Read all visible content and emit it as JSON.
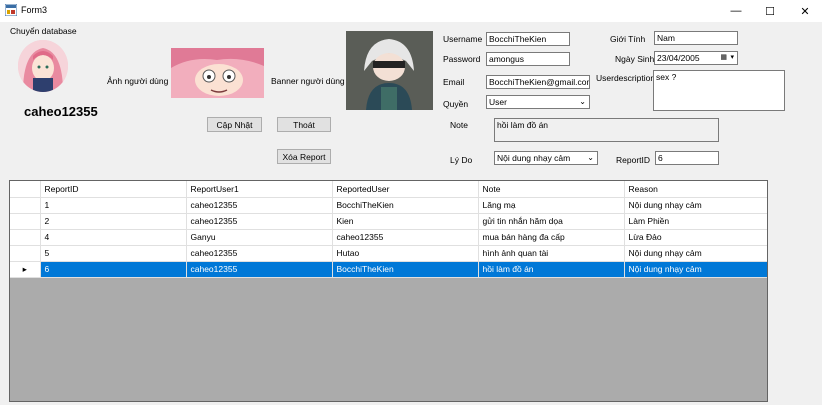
{
  "window": {
    "title": "Form3",
    "minimize": "—",
    "maximize": "☐",
    "close": "✕"
  },
  "menu": {
    "database": "Chuyển database"
  },
  "profile": {
    "username_display": "caheo12355",
    "avatar_label": "Ảnh người dùng",
    "banner_label": "Banner người dùng"
  },
  "buttons": {
    "update": "Cập Nhật",
    "exit": "Thoát",
    "delete_report": "Xóa Report"
  },
  "form": {
    "username_label": "Username",
    "username_value": "BocchiTheKien",
    "password_label": "Password",
    "password_value": "amongus",
    "email_label": "Email",
    "email_value": "BocchiTheKien@gmail.com",
    "role_label": "Quyền",
    "role_value": "User",
    "gender_label": "Giới Tính",
    "gender_value": "Nam",
    "birthday_label": "Ngày Sinh",
    "birthday_value": "23/04/2005",
    "description_label": "Userdescription",
    "description_value": "sex ?",
    "note_label": "Note",
    "note_value": "hồi làm đồ án",
    "reason_label": "Lý Do",
    "reason_value": "Nội dung nhạy cảm",
    "reportid_label": "ReportID",
    "reportid_value": "6"
  },
  "table": {
    "columns": [
      "ReportID",
      "ReportUser1",
      "ReportedUser",
      "Note",
      "Reason"
    ],
    "rows": [
      [
        "1",
        "caheo12355",
        "BocchiTheKien",
        "Lăng mạ",
        "Nội dung nhạy cảm"
      ],
      [
        "2",
        "caheo12355",
        "Kien",
        "gửi tin nhắn hăm dọa",
        "Làm Phiền"
      ],
      [
        "4",
        "Ganyu",
        "caheo12355",
        "mua bán hàng đa cấp",
        "Lừa Đảo"
      ],
      [
        "5",
        "caheo12355",
        "Hutao",
        "hình ảnh quan tài",
        "Nội dung nhạy cảm"
      ],
      [
        "6",
        "caheo12355",
        "BocchiTheKien",
        "hồi làm đồ án",
        "Nội dung nhạy cảm"
      ]
    ],
    "selected_row_index": 4,
    "row_indicator": "▸"
  }
}
